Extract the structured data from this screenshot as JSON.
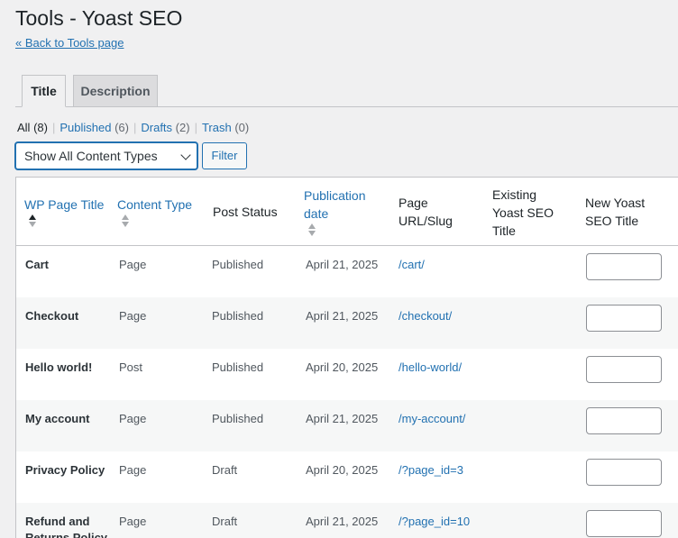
{
  "page": {
    "title": "Tools - Yoast SEO",
    "back_link": "« Back to Tools page"
  },
  "tabs": [
    {
      "label": "Title",
      "active": true
    },
    {
      "label": "Description",
      "active": false
    }
  ],
  "filters": {
    "all": {
      "label": "All",
      "count": "(8)"
    },
    "published": {
      "label": "Published",
      "count": "(6)"
    },
    "drafts": {
      "label": "Drafts",
      "count": "(2)"
    },
    "trash": {
      "label": "Trash",
      "count": "(0)"
    },
    "separator": "|"
  },
  "content_type_select": {
    "selected": "Show All Content Types"
  },
  "filter_button": "Filter",
  "table": {
    "columns": {
      "wp_page_title": "WP Page Title",
      "content_type": "Content Type",
      "post_status": "Post Status",
      "publication_date_1": "Publication",
      "publication_date_2": "date",
      "page_url_1": "Page",
      "page_url_2": "URL/Slug",
      "existing_1": "Existing",
      "existing_2": "Yoast SEO",
      "existing_3": "Title",
      "new_1": "New Yoast",
      "new_2": "SEO Title"
    },
    "rows": [
      {
        "title": "Cart",
        "type": "Page",
        "status": "Published",
        "date": "April 21, 2025",
        "url": "/cart/"
      },
      {
        "title": "Checkout",
        "type": "Page",
        "status": "Published",
        "date": "April 21, 2025",
        "url": "/checkout/"
      },
      {
        "title": "Hello world!",
        "type": "Post",
        "status": "Published",
        "date": "April 20, 2025",
        "url": "/hello-world/"
      },
      {
        "title": "My account",
        "type": "Page",
        "status": "Published",
        "date": "April 21, 2025",
        "url": "/my-account/"
      },
      {
        "title": "Privacy Policy",
        "type": "Page",
        "status": "Draft",
        "date": "April 20, 2025",
        "url": "/?page_id=3"
      },
      {
        "title": "Refund and Returns Policy",
        "type": "Page",
        "status": "Draft",
        "date": "April 21, 2025",
        "url": "/?page_id=10"
      }
    ]
  },
  "colors": {
    "link": "#2271b1",
    "background": "#f0f0f1",
    "row_alt": "#f6f7f7"
  }
}
